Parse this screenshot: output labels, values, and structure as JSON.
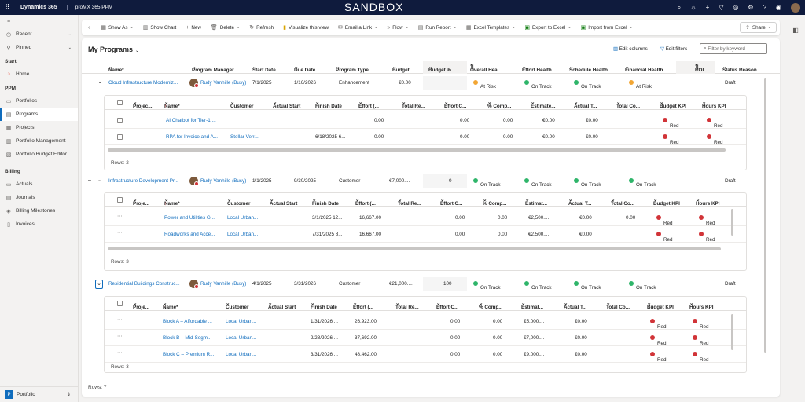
{
  "topbar": {
    "brand": "Dynamics 365",
    "app_name": "proMX 365 PPM",
    "env_label": "SANDBOX",
    "icons": [
      "search-icon",
      "lightbulb-icon",
      "plus-icon",
      "filter-icon",
      "help-icon",
      "settings-icon",
      "question-icon",
      "teams-icon",
      "avatar"
    ]
  },
  "sidebar": {
    "top_items": [
      {
        "label": "Recent",
        "icon": "clock-icon"
      },
      {
        "label": "Pinned",
        "icon": "pin-icon"
      }
    ],
    "start_head": "Start",
    "start_items": [
      {
        "label": "Home",
        "icon": "home-icon"
      }
    ],
    "ppm_head": "PPM",
    "ppm_items": [
      {
        "label": "Portfolios",
        "icon": "portfolio-icon"
      },
      {
        "label": "Programs",
        "icon": "programs-icon",
        "active": true
      },
      {
        "label": "Projects",
        "icon": "projects-icon"
      },
      {
        "label": "Portfolio Management",
        "icon": "portfolio-management-icon"
      },
      {
        "label": "Portfolio Budget Editor",
        "icon": "budget-editor-icon"
      }
    ],
    "billing_head": "Billing",
    "billing_items": [
      {
        "label": "Actuals",
        "icon": "actuals-icon"
      },
      {
        "label": "Journals",
        "icon": "journals-icon"
      },
      {
        "label": "Billing Milestones",
        "icon": "milestones-icon"
      },
      {
        "label": "Invoices",
        "icon": "invoices-icon"
      }
    ],
    "footer": {
      "badge": "P",
      "label": "Portfolio"
    }
  },
  "commands": {
    "show_as": "Show As",
    "show_chart": "Show Chart",
    "new": "New",
    "delete": "Delete",
    "refresh": "Refresh",
    "visualize": "Visualize this view",
    "email_link": "Email a Link",
    "flow": "Flow",
    "run_report": "Run Report",
    "excel_templates": "Excel Templates",
    "export_excel": "Export to Excel",
    "import_excel": "Import from Excel",
    "share": "Share"
  },
  "view": {
    "title": "My Programs",
    "edit_columns": "Edit columns",
    "edit_filters": "Edit filters",
    "filter_placeholder": "Filter by keyword",
    "footer": "Rows: 7"
  },
  "columns": {
    "name": "Name*",
    "program_manager": "Program Manager",
    "start_date": "Start Date",
    "due_date": "Due Date",
    "program_type": "Program Type",
    "budget": "Budget",
    "budget_pct": "Budget %",
    "overall_health": "Overall Heal...",
    "effort_health": "Effort Health",
    "schedule_health": "Schedule Health",
    "financial_health": "Financial Health",
    "roi": "ROI",
    "status_reason": "Status Reason"
  },
  "sub_columns": {
    "project": "Proje...",
    "project_alt": "Projec...",
    "name": "Name*",
    "customer": "Customer",
    "actual_start": "Actual Start",
    "finish_date": "Finish Date",
    "effort": "Effort (...",
    "total_re": "Total Re...",
    "effort_c": "Effort C...",
    "pct_comp": "% Comp...",
    "estimate": "Estimate...",
    "estimat2": "Estimat...",
    "actual_t": "Actual T...",
    "total_co": "Total Co...",
    "budget_kpi": "Budget KPI",
    "hours_kpi": "Hours KPI"
  },
  "status_colors": {
    "at_risk": "#f2a634",
    "on_track": "#2fb56a",
    "red": "#d13438"
  },
  "programs": [
    {
      "name": "Cloud Infrastructure Moderniz...",
      "manager": "Rudy Vanhille (Busy)",
      "start": "7/1/2025",
      "due": "1/16/2026",
      "type": "Enhancement",
      "budget": "€0.00",
      "budget_pct": "",
      "overall": "At Risk",
      "effort": "On Track",
      "schedule": "On Track",
      "financial": "At Risk",
      "status": "Draft",
      "rows_label": "Rows: 2",
      "projects": [
        {
          "name": "AI Chatbot for Tier-1 ...",
          "customer": "",
          "finish": "",
          "effort": "0.00",
          "effort_c": "0.00",
          "pct": "0.00",
          "estimate": "€0.00",
          "actual_t": "€0.00",
          "budget_kpi": "Red",
          "hours_kpi": "Red"
        },
        {
          "name": "RPA for Invoice and A...",
          "customer": "Stellar Vent...",
          "finish": "6/18/2025 6...",
          "effort": "0.00",
          "effort_c": "0.00",
          "pct": "0.00",
          "estimate": "€0.00",
          "actual_t": "€0.00",
          "budget_kpi": "Red",
          "hours_kpi": "Red"
        }
      ]
    },
    {
      "name": "Infrastructure Development Pr...",
      "manager": "Rudy Vanhille (Busy)",
      "start": "1/1/2025",
      "due": "9/30/2025",
      "type": "Customer",
      "budget": "€7,000....",
      "budget_pct": "0",
      "overall": "On Track",
      "effort": "On Track",
      "schedule": "On Track",
      "financial": "On Track",
      "status": "Draft",
      "rows_label": "Rows: 3",
      "projects": [
        {
          "name": "Power and Utilities G...",
          "customer": "Local Urban...",
          "finish": "3/1/2025 12...",
          "effort": "16,667.00",
          "effort_c": "0.00",
          "pct": "0.00",
          "estimate": "€2,500....",
          "actual_t": "€0.00",
          "total_co": "0.00",
          "budget_kpi": "Red",
          "hours_kpi": "Red"
        },
        {
          "name": "Roadworks and Acce...",
          "customer": "Local Urban...",
          "finish": "7/31/2025 8...",
          "effort": "16,667.00",
          "effort_c": "0.00",
          "pct": "0.00",
          "estimate": "€2,500....",
          "actual_t": "€0.00",
          "total_co": "",
          "budget_kpi": "Red",
          "hours_kpi": "Red"
        }
      ]
    },
    {
      "name": "Residential Buildings Construc...",
      "manager": "Rudy Vanhille (Busy)",
      "start": "4/1/2025",
      "due": "3/31/2026",
      "type": "Customer",
      "budget": "€21,000....",
      "budget_pct": "100",
      "overall": "On Track",
      "effort": "On Track",
      "schedule": "On Track",
      "financial": "On Track",
      "status": "Draft",
      "rows_label": "Rows: 3",
      "projects": [
        {
          "name": "Block A – Affordable ...",
          "customer": "Local Urban...",
          "finish": "1/31/2026 ...",
          "effort": "26,923.00",
          "effort_c": "0.00",
          "pct": "0.00",
          "estimate": "€5,000....",
          "actual_t": "€0.00",
          "budget_kpi": "Red",
          "hours_kpi": "Red"
        },
        {
          "name": "Block B – Mid-Segm...",
          "customer": "Local Urban...",
          "finish": "2/28/2026 ...",
          "effort": "37,692.00",
          "effort_c": "0.00",
          "pct": "0.00",
          "estimate": "€7,000....",
          "actual_t": "€0.00",
          "budget_kpi": "Red",
          "hours_kpi": "Red"
        },
        {
          "name": "Block C – Premium R...",
          "customer": "Local Urban...",
          "finish": "3/31/2026 ...",
          "effort": "48,462.00",
          "effort_c": "0.00",
          "pct": "0.00",
          "estimate": "€9,000....",
          "actual_t": "€0.00",
          "budget_kpi": "Red",
          "hours_kpi": "Red"
        }
      ]
    }
  ]
}
